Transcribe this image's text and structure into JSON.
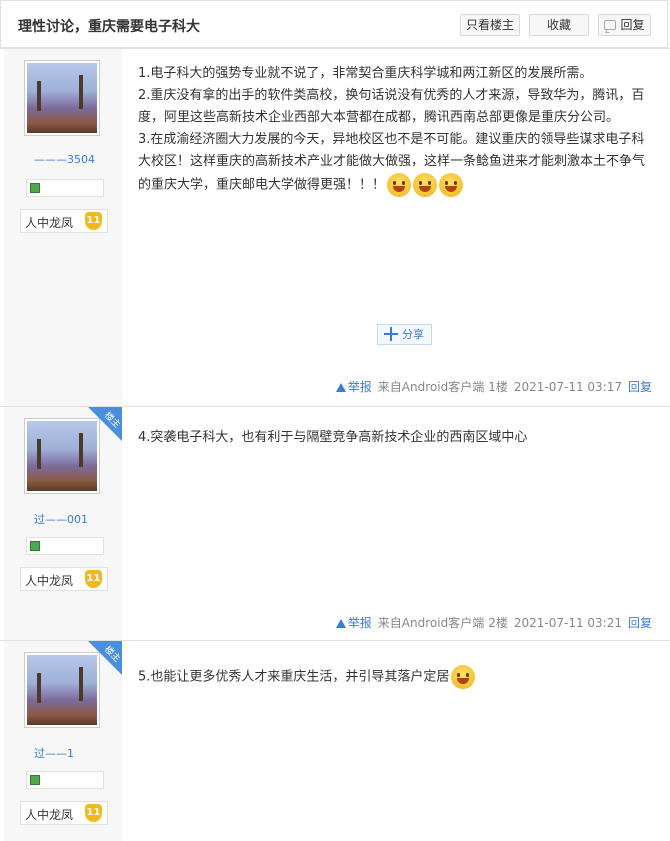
{
  "thread": {
    "title": "理性讨论，重庆需要电子科大",
    "buttons": {
      "only_op": "只看楼主",
      "favorite": "收藏",
      "reply": "回复"
    }
  },
  "posts": [
    {
      "username": "———3504",
      "rank": "人中龙凤",
      "level": "11",
      "op_badge": "",
      "lines": [
        "1.电子科大的强势专业就不说了，非常契合重庆科学城和两江新区的发展所需。",
        "2.重庆没有拿的出手的软件类高校，换句话说没有优秀的人才来源，导致华为，腾讯，百度，阿里这些高新技术企业西部大本营都在成都，腾讯西南总部更像是重庆分公司。",
        "3.在成渝经济圈大力发展的今天，异地校区也不是不可能。建议重庆的领导些谋求电子科大校区！这样重庆的高新技术产业才能做大做强，这样一条鲶鱼进来才能刺激本土不争气的重庆大学，重庆邮电大学做得更强！！！"
      ],
      "share": "分享",
      "report": "举报",
      "source": "来自Android客户端",
      "floor": "1楼",
      "time": "2021-07-11 03:17",
      "reply": "回复"
    },
    {
      "username": "过——001",
      "rank": "人中龙凤",
      "level": "11",
      "op_badge": "楼主",
      "lines": [
        "4.突袭电子科大，也有利于与隔壁竞争高新技术企业的西南区域中心"
      ],
      "report": "举报",
      "source": "来自Android客户端",
      "floor": "2楼",
      "time": "2021-07-11 03:21",
      "reply": "回复"
    },
    {
      "username": "过——1",
      "rank": "人中龙凤",
      "level": "11",
      "op_badge": "楼主",
      "lines": [
        "5.也能让更多优秀人才来重庆生活，并引导其落户定居"
      ]
    }
  ]
}
